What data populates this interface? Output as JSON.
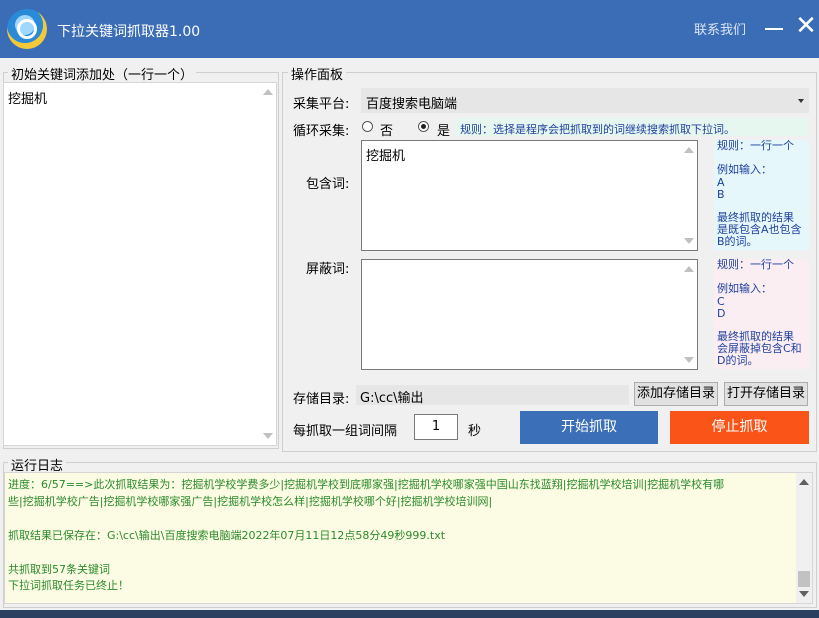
{
  "titlebar": {
    "title": "下拉关键词抓取器1.00",
    "contact": "联系我们",
    "minimize_icon": "minimize-icon",
    "close_icon": "close-icon",
    "close_glyph": "✕"
  },
  "left_panel": {
    "title": "初始关键词添加处（一行一个）",
    "keywords": "挖掘机"
  },
  "ops": {
    "title": "操作面板",
    "platform_label": "采集平台:",
    "platform_value": "百度搜索电脑端",
    "loop_label": "循环采集:",
    "loop_no": "否",
    "loop_yes": "是",
    "loop_selected": "是",
    "loop_rule": "规则：选择是程序会把抓取到的词继续搜索抓取下拉词。",
    "include_label": "包含词:",
    "include_value": "挖掘机",
    "include_note": [
      "规则：一行一个",
      "例如输入：",
      "A",
      "B",
      "最终抓取的结果",
      "是既包含A也包含",
      "B的词。"
    ],
    "block_label": "屏蔽词:",
    "block_value": "",
    "block_note": [
      "规则：一行一个",
      "例如输入：",
      "C",
      "D",
      "最终抓取的结果",
      "会屏蔽掉包含C和",
      "D的词。"
    ],
    "save_label": "存储目录:",
    "save_path": "G:\\cc\\输出",
    "add_dir": "添加存储目录",
    "open_dir": "打开存储目录",
    "interval_label": "每抓取一组词间隔",
    "interval_value": "1",
    "interval_unit": "秒",
    "start": "开始抓取",
    "stop": "停止抓取"
  },
  "log": {
    "title": "运行日志",
    "lines": [
      "进度：6/57==>此次抓取结果为：挖掘机学校学费多少|挖掘机学校到底哪家强|挖掘机学校哪家强中国山东找蓝翔|挖掘机学校培训|挖掘机学校有哪",
      "些|挖掘机学校广告|挖掘机学校哪家强广告|挖掘机学校怎么样|挖掘机学校哪个好|挖掘机学校培训网|",
      "",
      "抓取结果已保存在：G:\\cc\\输出\\百度搜索电脑端2022年07月11日12点58分49秒999.txt",
      "",
      "共抓取到57条关键词",
      "下拉词抓取任务已终止！"
    ]
  },
  "colors": {
    "titlebar": "#3a6db5",
    "start_button": "#3b6fb7",
    "stop_button": "#fb5419",
    "log_text": "#2a8a2a",
    "hint_text": "#1f3f9f"
  }
}
